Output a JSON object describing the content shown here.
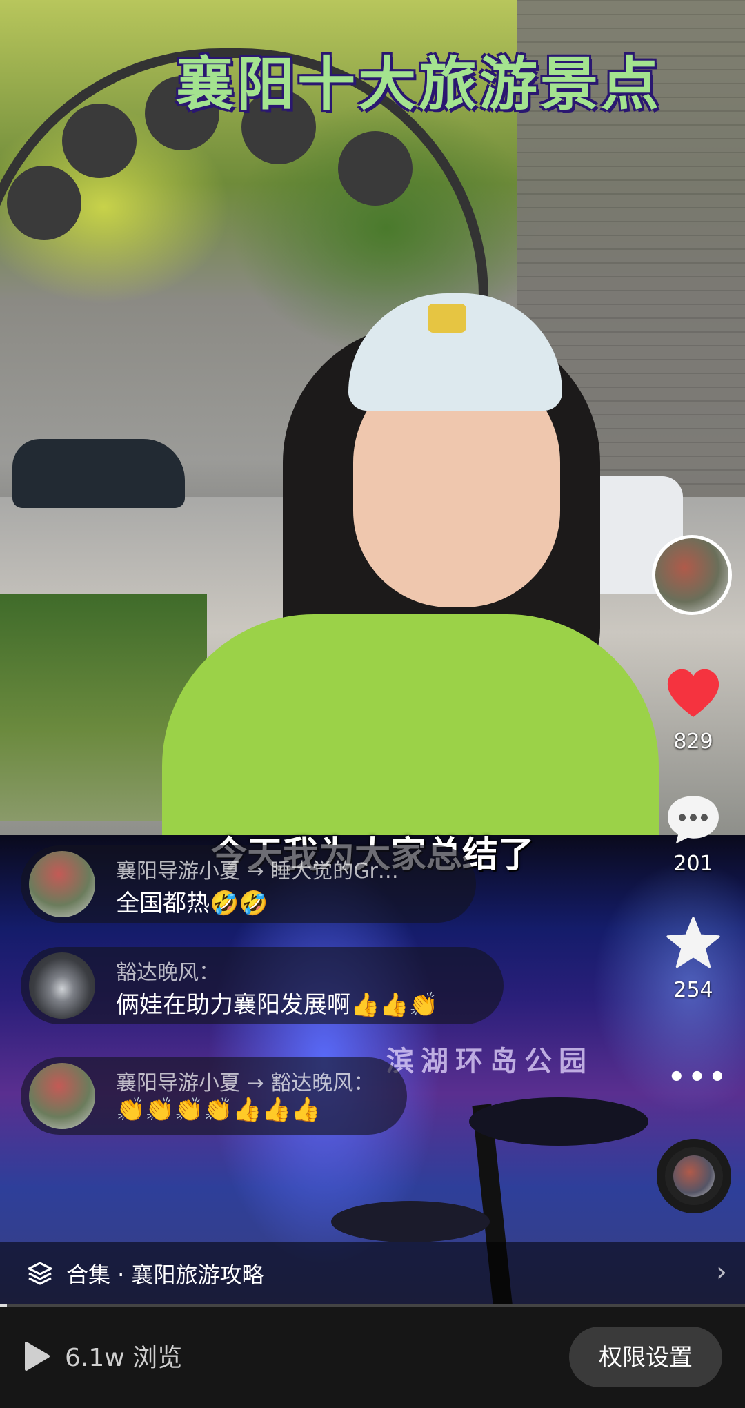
{
  "video": {
    "title_overlay": "襄阳十大旅游景点",
    "subtitle": "今天我为大家总结了",
    "background_sign_text": "滨湖环岛公园"
  },
  "actions": {
    "likes": "829",
    "comments": "201",
    "favorites": "254"
  },
  "comments": [
    {
      "author": "襄阳导游小夏 → 睡大觉的Gr…",
      "text": "全国都热🤣🤣"
    },
    {
      "author": "豁达晚风：",
      "text": "俩娃在助力襄阳发展啊👍👍👏"
    },
    {
      "author": "襄阳导游小夏 → 豁达晚风：",
      "text": "👏👏👏👏👍👍👍"
    }
  ],
  "collection": {
    "label": "合集 · 襄阳旅游攻略",
    "chevron": "›"
  },
  "bottom_bar": {
    "views": "6.1w 浏览",
    "permission_button": "权限设置"
  },
  "icons": {
    "like": "heart-icon",
    "comment": "comment-bubble-icon",
    "favorite": "star-icon",
    "more": "more-dots-icon",
    "collection": "layers-icon",
    "play": "play-icon"
  },
  "colors": {
    "like_red": "#f5333f",
    "title_green": "#a4e38f",
    "bottom_bar_bg": "#161616"
  }
}
